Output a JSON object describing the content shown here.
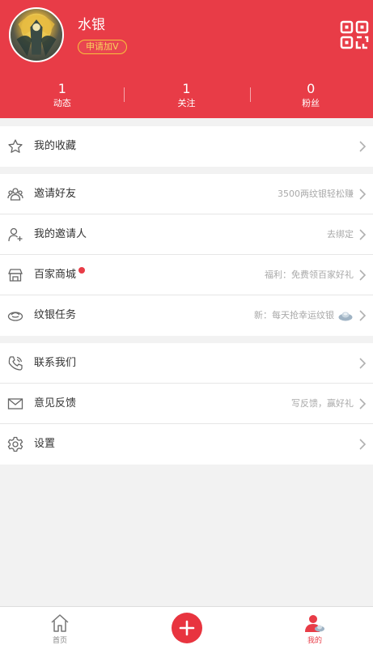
{
  "profile": {
    "username": "水银",
    "badge": "申请加V"
  },
  "stats": [
    {
      "value": "1",
      "label": "动态"
    },
    {
      "value": "1",
      "label": "关注"
    },
    {
      "value": "0",
      "label": "粉丝"
    }
  ],
  "menu": {
    "favorites": {
      "title": "我的收藏"
    },
    "invite_friends": {
      "title": "邀请好友",
      "hint": "3500两纹银轻松赚"
    },
    "my_inviter": {
      "title": "我的邀请人",
      "hint": "去绑定"
    },
    "mall": {
      "title": "百家商城",
      "hint": "福利：免费领百家好礼"
    },
    "tasks": {
      "title": "纹银任务",
      "hint": "新：每天抢幸运纹银"
    },
    "contact": {
      "title": "联系我们"
    },
    "feedback": {
      "title": "意见反馈",
      "hint": "写反馈，赢好礼"
    },
    "settings": {
      "title": "设置"
    }
  },
  "tabbar": {
    "home": "首页",
    "mine": "我的"
  },
  "colors": {
    "brand_red": "#e83c47",
    "badge_gold": "#f7c23b"
  },
  "icons": [
    "qr-code-icon",
    "star-icon",
    "friends-icon",
    "add-user-icon",
    "shop-icon",
    "silver-ingot-icon",
    "phone-icon",
    "mail-icon",
    "gear-icon",
    "chevron-right-icon",
    "home-icon",
    "plus-icon",
    "profile-icon"
  ]
}
